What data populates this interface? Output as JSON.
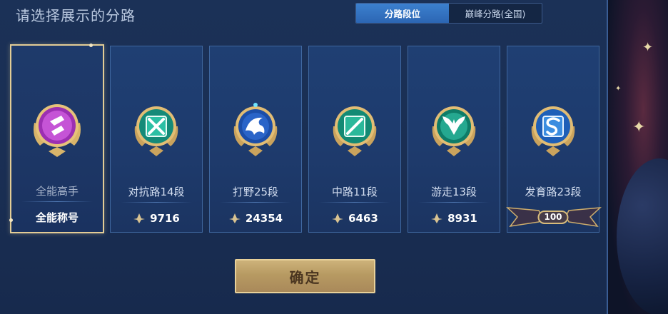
{
  "header": {
    "title": "请选择展示的分路"
  },
  "tabs": [
    {
      "label": "分路段位",
      "active": true
    },
    {
      "label": "巅峰分路(全国)",
      "active": false
    }
  ],
  "cards": [
    {
      "rank": "全能高手",
      "title_text": "全能称号",
      "selected": true,
      "emblem_color": "#b541c7"
    },
    {
      "rank": "对抗路14段",
      "score": "9716",
      "emblem_color": "#2bbfa4"
    },
    {
      "rank": "打野25段",
      "score": "24354",
      "emblem_color": "#2a64c8"
    },
    {
      "rank": "中路11段",
      "score": "6463",
      "emblem_color": "#2ab89a"
    },
    {
      "rank": "游走13段",
      "score": "8931",
      "emblem_color": "#25a890"
    },
    {
      "rank": "发育路23段",
      "badge": "100",
      "emblem_color": "#3b8de0"
    }
  ],
  "confirm_label": "确定",
  "colors": {
    "gold": "#e3cd96",
    "accent_blue": "#3c80cf",
    "panel": "#1b3157"
  }
}
